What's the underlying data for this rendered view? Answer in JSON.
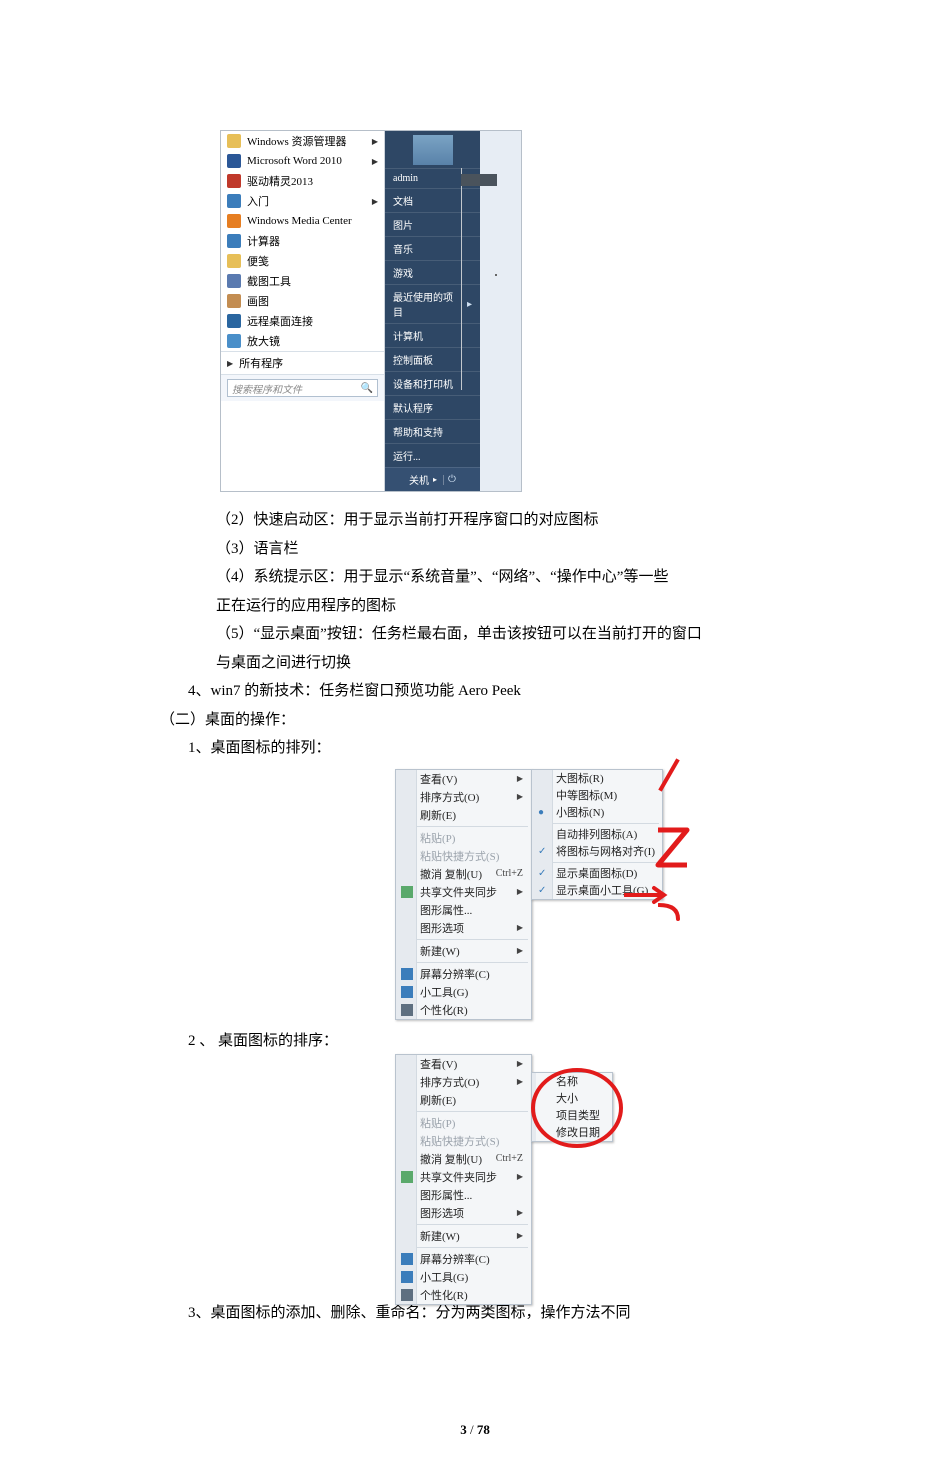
{
  "start_menu": {
    "left": [
      {
        "label": "Windows 资源管理器",
        "icon": "ic-yellow",
        "arrow": true
      },
      {
        "label": "Microsoft Word 2010",
        "icon": "ic-word",
        "arrow": true
      },
      {
        "label": "驱动精灵2013",
        "icon": "ic-red",
        "arrow": false
      },
      {
        "label": "入门",
        "icon": "ic-blue",
        "arrow": true
      },
      {
        "label": "Windows Media Center",
        "icon": "ic-orange",
        "arrow": false
      },
      {
        "label": "计算器",
        "icon": "ic-blue",
        "arrow": false
      },
      {
        "label": "便笺",
        "icon": "ic-yellow",
        "arrow": false
      },
      {
        "label": "截图工具",
        "icon": "ic-sciss",
        "arrow": false
      },
      {
        "label": "画图",
        "icon": "ic-pal",
        "arrow": false
      },
      {
        "label": "远程桌面连接",
        "icon": "ic-rdp",
        "arrow": false
      },
      {
        "label": "放大镜",
        "icon": "ic-mag",
        "arrow": false
      }
    ],
    "all_programs": "所有程序",
    "search_placeholder": "搜索程序和文件",
    "right": [
      "admin",
      "文档",
      "图片",
      "音乐",
      "游戏",
      "最近使用的项目",
      "计算机",
      "控制面板",
      "设备和打印机",
      "默认程序",
      "帮助和支持",
      "运行..."
    ],
    "right_arrow_index": 5,
    "shutdown": "关机"
  },
  "paragraphs": {
    "p2": "（2）快速启动区：用于显示当前打开程序窗口的对应图标",
    "p3": "（3）语言栏",
    "p4a": "（4）系统提示区：用于显示“系统音量”、“网络”、“操作中心”等一些",
    "p4b": "正在运行的应用程序的图标",
    "p5a": "（5）“显示桌面”按钮：任务栏最右面，单击该按钮可以在当前打开的窗口",
    "p5b": "与桌面之间进行切换",
    "p6": "4、win7 的新技术：任务栏窗口预览功能 Aero  Peek",
    "h2": "（二）桌面的操作：",
    "p7": "1、桌面图标的排列：",
    "p8": "2 、 桌面图标的排序：",
    "p9": "3、桌面图标的添加、删除、重命名：分为两类图标，操作方法不同"
  },
  "menu1": {
    "items": [
      {
        "t": "查看(V)",
        "arrow": true
      },
      {
        "t": "排序方式(O)",
        "arrow": true
      },
      {
        "t": "刷新(E)"
      },
      {
        "sep": true
      },
      {
        "t": "粘贴(P)",
        "disabled": true
      },
      {
        "t": "粘贴快捷方式(S)",
        "disabled": true
      },
      {
        "t": "撤消 复制(U)",
        "sc": "Ctrl+Z"
      },
      {
        "t": "共享文件夹同步",
        "arrow": true,
        "icon": "sq-refresh"
      },
      {
        "t": "图形属性..."
      },
      {
        "t": "图形选项",
        "arrow": true
      },
      {
        "sep": true
      },
      {
        "t": "新建(W)",
        "arrow": true
      },
      {
        "sep": true
      },
      {
        "t": "屏幕分辨率(C)",
        "icon": "sq-blue"
      },
      {
        "t": "小工具(G)",
        "icon": "sq-blue"
      },
      {
        "t": "个性化(R)",
        "icon": "sq-pers"
      }
    ],
    "sub": [
      {
        "t": "大图标(R)"
      },
      {
        "t": "中等图标(M)"
      },
      {
        "t": "小图标(N)",
        "mark": "●"
      },
      {
        "sep": true
      },
      {
        "t": "自动排列图标(A)"
      },
      {
        "t": "将图标与网格对齐(I)",
        "mark": "✓"
      },
      {
        "sep": true
      },
      {
        "t": "显示桌面图标(D)",
        "mark": "✓"
      },
      {
        "t": "显示桌面小工具(G)",
        "mark": "✓"
      }
    ]
  },
  "menu2": {
    "items": [
      {
        "t": "查看(V)",
        "arrow": true
      },
      {
        "t": "排序方式(O)",
        "arrow": true
      },
      {
        "t": "刷新(E)"
      },
      {
        "sep": true
      },
      {
        "t": "粘贴(P)",
        "disabled": true
      },
      {
        "t": "粘贴快捷方式(S)",
        "disabled": true
      },
      {
        "t": "撤消 复制(U)",
        "sc": "Ctrl+Z"
      },
      {
        "t": "共享文件夹同步",
        "arrow": true,
        "icon": "sq-refresh"
      },
      {
        "t": "图形属性..."
      },
      {
        "t": "图形选项",
        "arrow": true
      },
      {
        "sep": true
      },
      {
        "t": "新建(W)",
        "arrow": true
      },
      {
        "sep": true
      },
      {
        "t": "屏幕分辨率(C)",
        "icon": "sq-blue"
      },
      {
        "t": "小工具(G)",
        "icon": "sq-blue"
      },
      {
        "t": "个性化(R)",
        "icon": "sq-pers"
      }
    ],
    "sub": [
      {
        "t": "名称"
      },
      {
        "t": "大小"
      },
      {
        "t": "项目类型"
      },
      {
        "t": "修改日期"
      }
    ]
  },
  "footer": {
    "page": "3",
    "total": "78",
    "sep": " / "
  }
}
